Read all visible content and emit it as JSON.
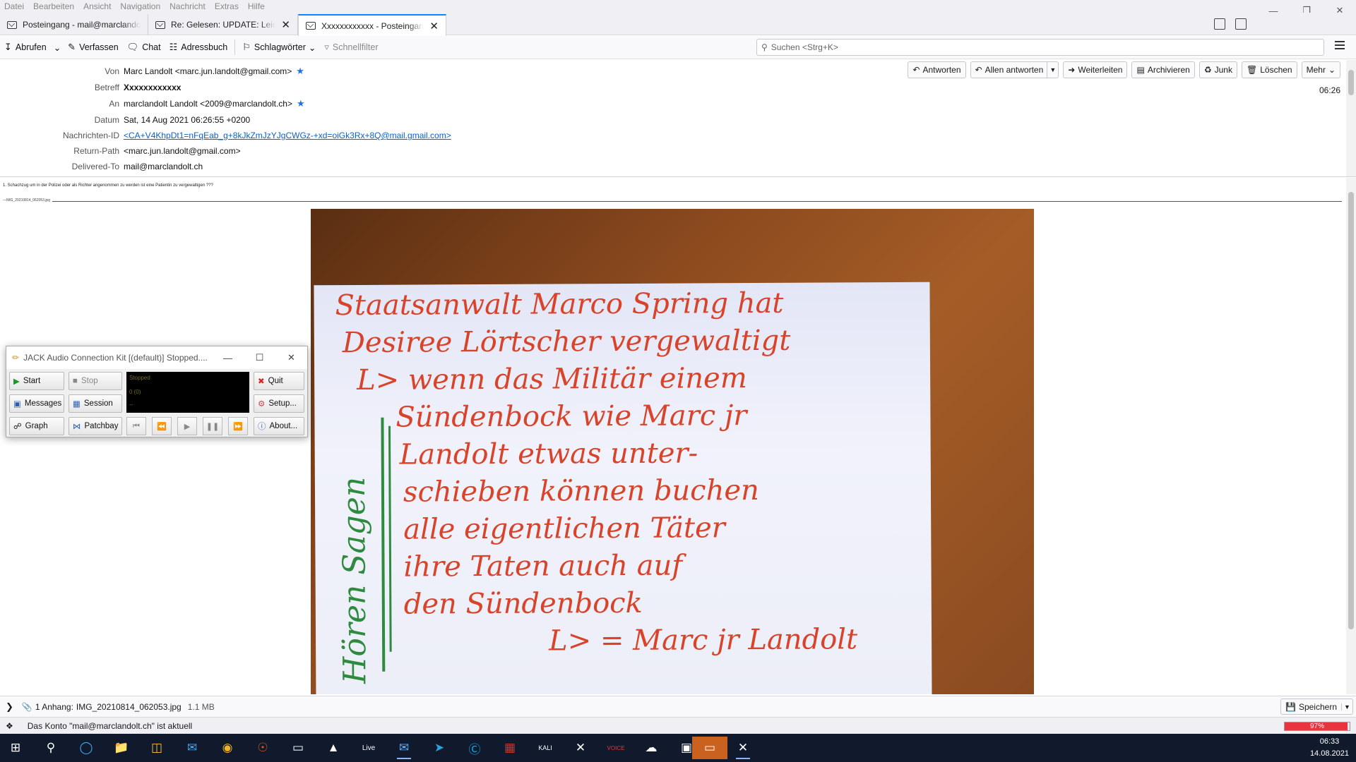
{
  "menu": [
    "Datei",
    "Bearbeiten",
    "Ansicht",
    "Navigation",
    "Nachricht",
    "Extras",
    "Hilfe"
  ],
  "tabs": [
    {
      "label": "Posteingang - mail@marclandolt.ch",
      "active": false,
      "closable": false
    },
    {
      "label": "Re: Gelesen: UPDATE: Leicht",
      "active": false,
      "closable": true
    },
    {
      "label": "Xxxxxxxxxxxx - Posteingang",
      "active": true,
      "closable": true
    }
  ],
  "toolbar": {
    "abrufen": "Abrufen",
    "verfassen": "Verfassen",
    "chat": "Chat",
    "adressbuch": "Adressbuch",
    "schlagwoerter": "Schlagwörter",
    "schnellfilter": "Schnellfilter",
    "search_placeholder": "Suchen <Strg+K>"
  },
  "header_buttons": {
    "antworten": "Antworten",
    "allen_antworten": "Allen antworten",
    "weiterleiten": "Weiterleiten",
    "archivieren": "Archivieren",
    "junk": "Junk",
    "loeschen": "Löschen",
    "mehr": "Mehr"
  },
  "message": {
    "time": "06:26",
    "from_label": "Von",
    "from": "Marc Landolt <marc.jun.landolt@gmail.com>",
    "subject_label": "Betreff",
    "subject": "Xxxxxxxxxxxx",
    "to_label": "An",
    "to": "marclandolt Landolt <2009@marclandolt.ch>",
    "date_label": "Datum",
    "date": "Sat, 14 Aug 2021 06:26:55 +0200",
    "msgid_label": "Nachrichten-ID",
    "msgid": "<CA+V4KhpDt1=nFqEab_g+8kJkZmJzYJgCWGz-+xd=oiGk3Rx+8Q@mail.gmail.com>",
    "returnpath_label": "Return-Path",
    "returnpath": "<marc.jun.landolt@gmail.com>",
    "deliveredto_label": "Delivered-To",
    "deliveredto": "mail@marclandolt.ch",
    "body_text": "1. Schachzug um in der Polizei oder als Richter angenommen zu werden ist eine Patientin zu vergewaltigen ???",
    "divider_text": "—IMG_20210814_062053.jpg",
    "note_lines": [
      "Staatsanwalt Marco Spring hat",
      "Desiree Lörtscher vergewaltigt",
      "L> wenn das Militär einem",
      "Sündenbock wie Marc jr",
      "Landolt etwas unter-",
      "schieben können buchen",
      "alle eigentlichen Täter",
      "ihre Taten auch auf",
      "den Sündenbock",
      "L> = Marc jr Landolt"
    ],
    "note_side": "Hören Sagen"
  },
  "attachment": {
    "label": "1 Anhang:",
    "filename": "IMG_20210814_062053.jpg",
    "size": "1.1 MB",
    "save": "Speichern"
  },
  "status": {
    "text": "Das Konto \"mail@marclandolt.ch\" ist aktuell",
    "progress": 0.97,
    "progress_label": "97%"
  },
  "jack": {
    "title": "JACK Audio Connection Kit [(default)] Stopped....",
    "start": "Start",
    "stop": "Stop",
    "quit": "Quit",
    "messages": "Messages",
    "session": "Session",
    "setup": "Setup...",
    "graph": "Graph",
    "patchbay": "Patchbay",
    "about": "About...",
    "display_status": "Stopped",
    "display_xruns": "0 (0)",
    "display_time": "--"
  },
  "taskbar": {
    "time": "06:33",
    "date": "14.08.2021",
    "icons": [
      "windows-start",
      "search",
      "edge",
      "explorer",
      "store",
      "mail",
      "chrome",
      "ubuntu",
      "terminal",
      "inkscape",
      "live",
      "thunderbird",
      "telegram",
      "skype",
      "filezilla",
      "kali",
      "jack",
      "voicemeeter",
      "nextcloud",
      "desktop",
      "window",
      "xjack"
    ]
  },
  "colors": {
    "accent": "#0a84ff",
    "link": "#0a61c8",
    "taskbar": "#101a2c",
    "ink_red": "#d8432a",
    "ink_green": "#2e8a3e"
  }
}
